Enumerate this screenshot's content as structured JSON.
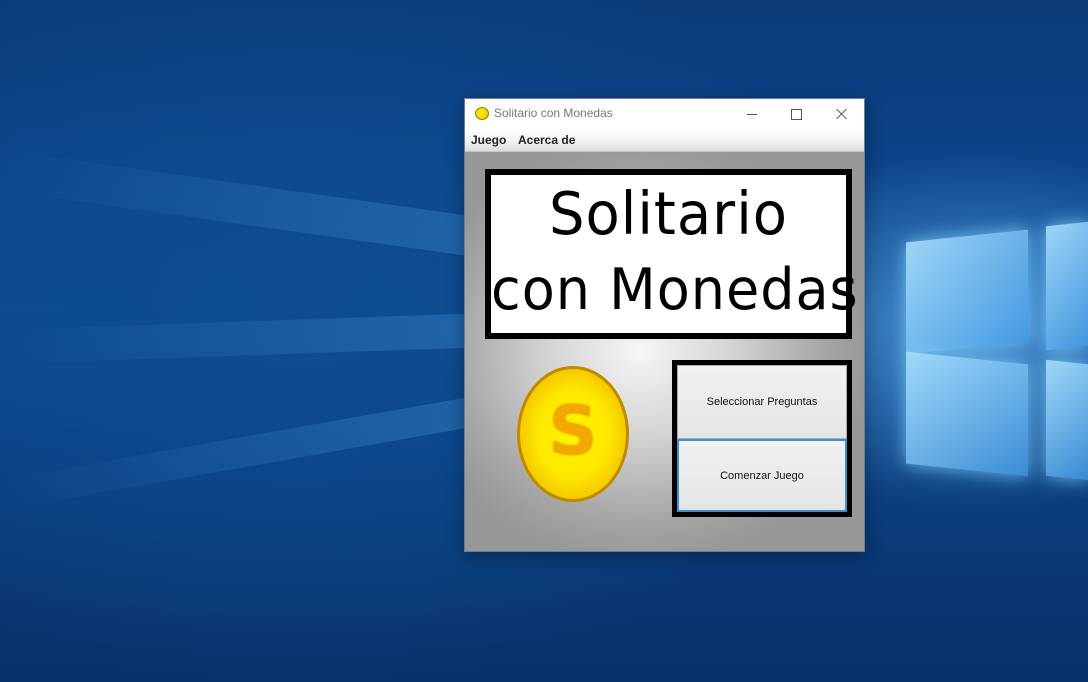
{
  "window": {
    "title": "Solitario con Monedas"
  },
  "menu": {
    "items": [
      "Juego",
      "Acerca de"
    ]
  },
  "banner": {
    "line1": "Solitario",
    "line2": "con Monedas"
  },
  "coin": {
    "letter": "S",
    "color": "#ffe800"
  },
  "buttons": {
    "select_questions": "Seleccionar Preguntas",
    "start_game": "Comenzar Juego"
  },
  "colors": {
    "desktop": "#0c4a95",
    "focus_border": "#3b8fd8"
  }
}
